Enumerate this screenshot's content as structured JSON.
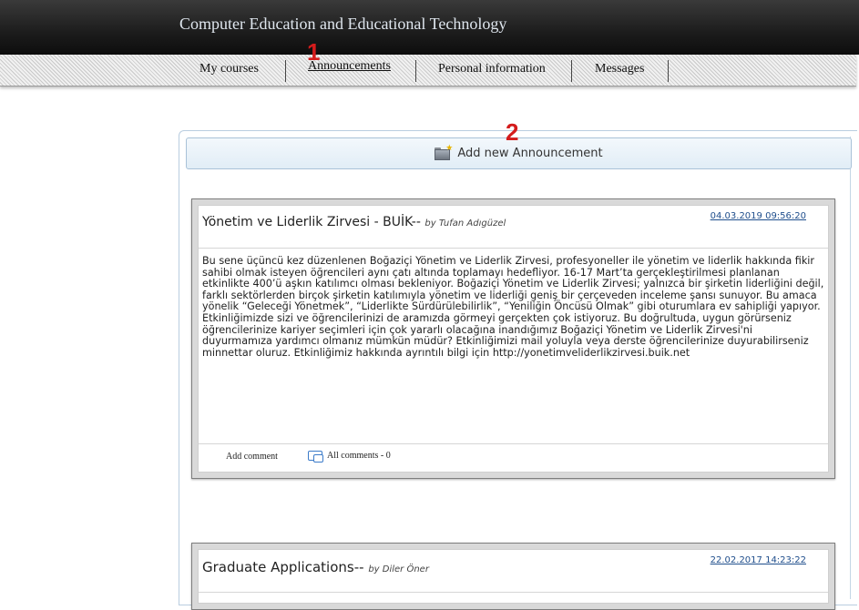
{
  "header": {
    "site_title": "Computer Education and Educational Technology"
  },
  "nav": {
    "items": [
      {
        "label": "My courses"
      },
      {
        "label": "Announcements"
      },
      {
        "label": "Personal information"
      },
      {
        "label": "Messages"
      }
    ]
  },
  "markers": {
    "step1": "1",
    "step2": "2"
  },
  "toolbar": {
    "add_label": "Add new Announcement",
    "add_icon": "folder-add-icon"
  },
  "announcements": [
    {
      "title": "Yönetim ve Liderlik Zirvesi - BUİK--",
      "author": "by Tufan Adıgüzel",
      "date": "04.03.2019 09:56:20",
      "body": "Bu sene üçüncü kez düzenlenen Boğaziçi Yönetim ve Liderlik Zirvesi, profesyoneller ile yönetim ve liderlik hakkında fikir sahibi olmak isteyen öğrencileri aynı çatı altında toplamayı hedefliyor. 16-17 Mart’ta gerçekleştirilmesi planlanan etkinlikte 400’ü aşkın katılımcı olması bekleniyor. Boğaziçi Yönetim ve Liderlik Zirvesi; yalnızca bir şirketin liderliğini değil, farklı sektörlerden birçok şirketin katılımıyla yönetim ve liderliği geniş bir çerçeveden inceleme şansı sunuyor. Bu amaca yönelik “Geleceği Yönetmek”, “Liderlikte Sürdürülebilirlik”, “Yeniliğin Öncüsü Olmak” gibi oturumlara ev sahipliği yapıyor. Etkinliğimizde sizi ve öğrencilerinizi de aramızda görmeyi gerçekten çok istiyoruz. Bu doğrultuda, uygun görürseniz öğrencilerinize kariyer seçimleri için çok yararlı olacağına inandığımız Boğaziçi Yönetim ve Liderlik Zirvesi'ni duyurmamıza yardımcı olmanız mümkün müdür? Etkinliğimizi mail yoluyla veya derste öğrencilerinize duyurabilirseniz minnettar oluruz. Etkinliğimiz hakkında ayrıntılı bilgi için http://yonetimveliderlikzirvesi.buik.net",
      "add_comment": "Add comment",
      "all_comments": "All comments - 0"
    },
    {
      "title": "Graduate Applications--",
      "author": "by Diler Öner",
      "date": "22.02.2017 14:23:22"
    }
  ]
}
